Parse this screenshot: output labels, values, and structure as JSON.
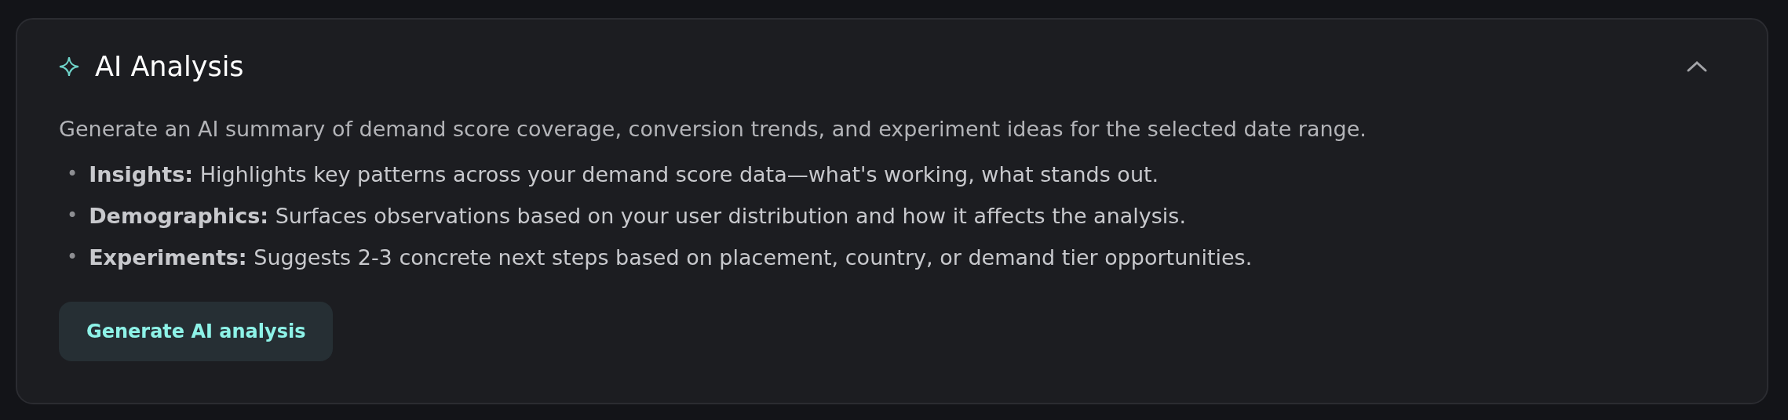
{
  "panel": {
    "title": "AI Analysis",
    "expanded": true,
    "description": "Generate an AI summary of demand score coverage, conversion trends, and experiment ideas for the selected date range.",
    "items": [
      {
        "bullet": "•",
        "text": "**Insights:** Highlights key patterns across your demand score data—what's working, what stands out."
      },
      {
        "bullet": "•",
        "text": "**Demographics:** Surfaces observations based on your user distribution and how it affects the analysis."
      },
      {
        "bullet": "•",
        "text": "**Experiments:** Suggests 2-3 concrete next steps based on placement, country, or demand tier opportunities."
      }
    ],
    "button": "Generate AI analysis"
  }
}
